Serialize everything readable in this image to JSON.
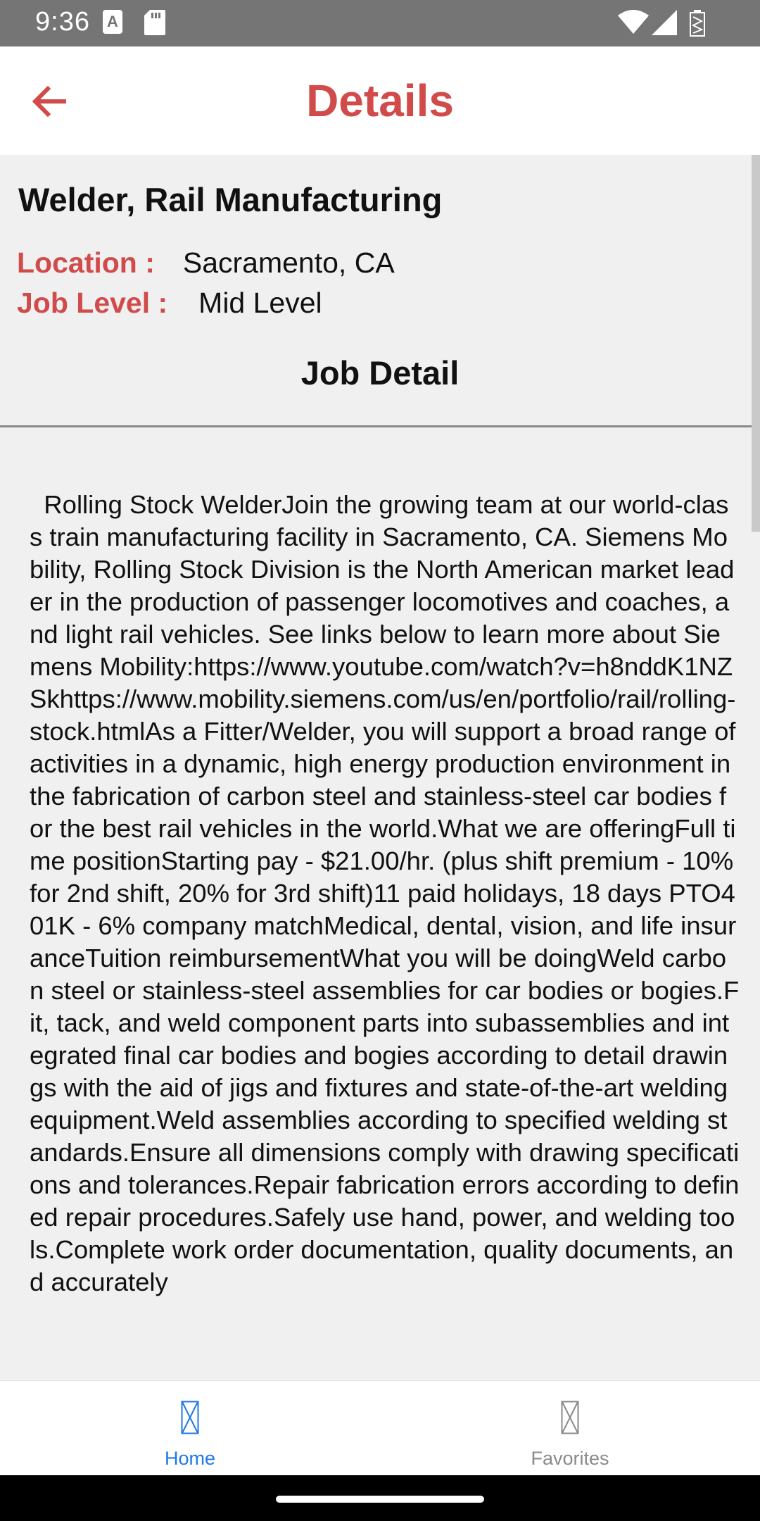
{
  "status_bar": {
    "time": "9:36",
    "icons": [
      "a-notification-icon",
      "sd-card-icon",
      "wifi-icon",
      "cell-signal-icon",
      "battery-icon"
    ]
  },
  "app_bar": {
    "title": "Details",
    "back_icon": "arrow-back-icon",
    "accent_color": "#d14b4b"
  },
  "job": {
    "title": "Welder, Rail Manufacturing",
    "location_label": "Location :",
    "location_value": "Sacramento, CA",
    "level_label": "Job Level :",
    "level_value": "Mid Level",
    "section_heading": "Job Detail",
    "description": "  Rolling Stock WelderJoin the growing team at our world-class train manufacturing facility in Sacramento, CA. Siemens Mobility, Rolling Stock Division is the North American market leader in the production of passenger locomotives and coaches, and light rail vehicles. See links below to learn more about Siemens Mobility:https://www.youtube.com/watch?v=h8nddK1NZSkhttps://www.mobility.siemens.com/us/en/portfolio/rail/rolling-stock.htmlAs a Fitter/Welder, you will support a broad range of activities in a dynamic, high energy production environment in the fabrication of carbon steel and stainless-steel car bodies for the best rail vehicles in the world.What we are offeringFull time positionStarting pay - $21.00/hr. (plus shift premium - 10% for 2nd shift, 20% for 3rd shift)11 paid holidays, 18 days PTO401K - 6% company matchMedical, dental, vision, and life insuranceTuition reimbursementWhat you will be doingWeld carbon steel or stainless-steel assemblies for car bodies or bogies.Fit, tack, and weld component parts into subassemblies and integrated final car bodies and bogies according to detail drawings with the aid of jigs and fixtures and state-of-the-art welding equipment.Weld assemblies according to specified welding standards.Ensure all dimensions comply with drawing specifications and tolerances.Repair fabrication errors according to defined repair procedures.Safely use hand, power, and welding tools.Complete work order documentation, quality documents, and accurately"
  },
  "bottom_nav": {
    "items": [
      {
        "label": "Home",
        "icon": "home-icon",
        "active": true,
        "color": "#1e78e6"
      },
      {
        "label": "Favorites",
        "icon": "favorites-icon",
        "active": false,
        "color": "#8a8a8a"
      }
    ]
  }
}
